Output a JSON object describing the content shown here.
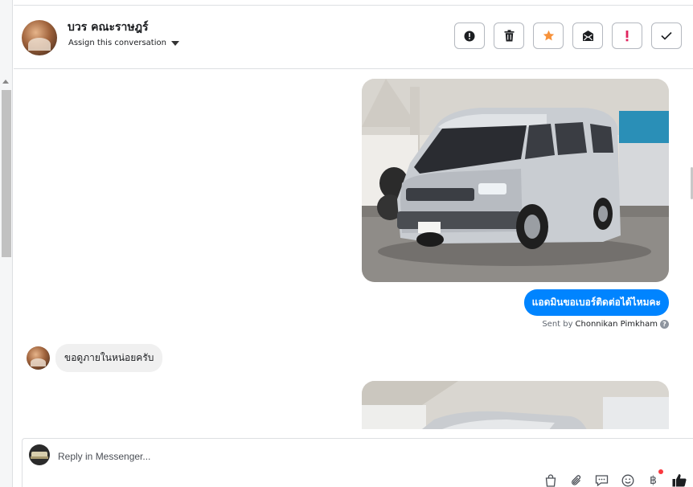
{
  "header": {
    "contact_name": "บวร คณะราษฎร์",
    "assign_label": "Assign this conversation",
    "actions": [
      {
        "name": "mark-spam-button",
        "icon": "alert-circle-icon",
        "color": "#1c1e21"
      },
      {
        "name": "delete-button",
        "icon": "trash-icon",
        "color": "#1c1e21"
      },
      {
        "name": "star-button",
        "icon": "star-icon",
        "color": "#f7923b"
      },
      {
        "name": "mark-unread-button",
        "icon": "envelope-icon",
        "color": "#1c1e21"
      },
      {
        "name": "follow-up-button",
        "icon": "exclamation-icon",
        "color": "#e0245e"
      },
      {
        "name": "mark-done-button",
        "icon": "checkmark-icon",
        "color": "#1c1e21"
      }
    ]
  },
  "thread": {
    "outgoing_text": "แอดมินขอเบอร์ติดต่อได้ไหมคะ",
    "sent_by_prefix": "Sent by",
    "sent_by_name": "Chonnikan Pimkham",
    "incoming_text": "ขอดูภายในหน่อยครับ",
    "outgoing_color": "#0084ff"
  },
  "composer": {
    "placeholder": "Reply in Messenger...",
    "tools": [
      {
        "name": "shop-bag-icon"
      },
      {
        "name": "paperclip-icon"
      },
      {
        "name": "saved-reply-icon"
      },
      {
        "name": "emoji-icon"
      },
      {
        "name": "baht-payment-icon",
        "label": "฿"
      },
      {
        "name": "thumbs-up-icon"
      }
    ]
  }
}
